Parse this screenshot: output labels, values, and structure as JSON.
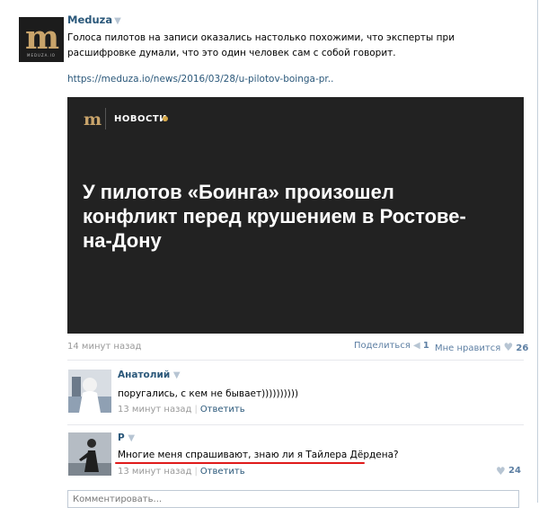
{
  "post": {
    "author": "Meduza",
    "author_dropdown": "▼",
    "avatar_letter": "m",
    "avatar_tag": "MEDUZA.IO",
    "text": "Голоса пилотов на записи оказались настолько похожими, что эксперты при расшифровке думали, что это один человек сам с собой говорит.",
    "link": "https://meduza.io/news/2016/03/28/u-pilotov-boinga-pr..",
    "card": {
      "logo": "m",
      "section": "НОВОСТИ",
      "headline": "У пилотов «Боинга» произошел конфликт перед крушением в Ростове-на-Дону"
    },
    "time": "14 минут назад",
    "share_label": "Поделиться",
    "share_count": "1",
    "like_label": "Мне нравится",
    "like_count": "26"
  },
  "comments": [
    {
      "name": "Анатолий",
      "dropdown": "▼",
      "text": "поругались, с кем не бывает))))))))))",
      "time": "13 минут назад",
      "reply": "Ответить"
    },
    {
      "name": "Р",
      "dropdown": "▼",
      "text": "Многие меня спрашивают, знаю ли я Тайлера Дёрдена?",
      "time": "13 минут назад",
      "reply": "Ответить",
      "likes": "24"
    }
  ],
  "comment_input": {
    "placeholder": "Комментировать..."
  },
  "colors": {
    "link": "#2b587a",
    "card_bg": "#222222",
    "brand_gold": "#c9a46b",
    "highlight": "#e01b1b"
  },
  "icons": {
    "share": "megaphone-icon",
    "like": "heart-icon"
  }
}
